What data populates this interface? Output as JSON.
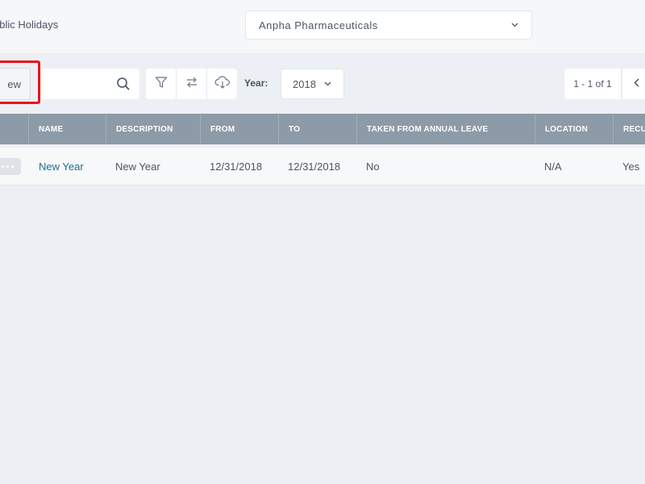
{
  "header": {
    "title": "ublic Holidays",
    "company": "Anpha Pharmaceuticals"
  },
  "toolbar": {
    "new_label": "ew",
    "search_value": "",
    "year_label": "Year:",
    "year_value": "2018",
    "pager_info": "1 - 1 of 1"
  },
  "table": {
    "columns": [
      "NAME",
      "DESCRIPTION",
      "FROM",
      "TO",
      "TAKEN FROM ANNUAL LEAVE",
      "LOCATION",
      "RECU"
    ],
    "rows": [
      {
        "name": "New Year",
        "description": "New Year",
        "from": "12/31/2018",
        "to": "12/31/2018",
        "taken_from_annual_leave": "No",
        "location": "N/A",
        "recurring": "Yes"
      }
    ]
  },
  "colors": {
    "accent_link": "#1d6f8f",
    "table_header": "#8d9aa8",
    "highlight": "#e8141c"
  }
}
